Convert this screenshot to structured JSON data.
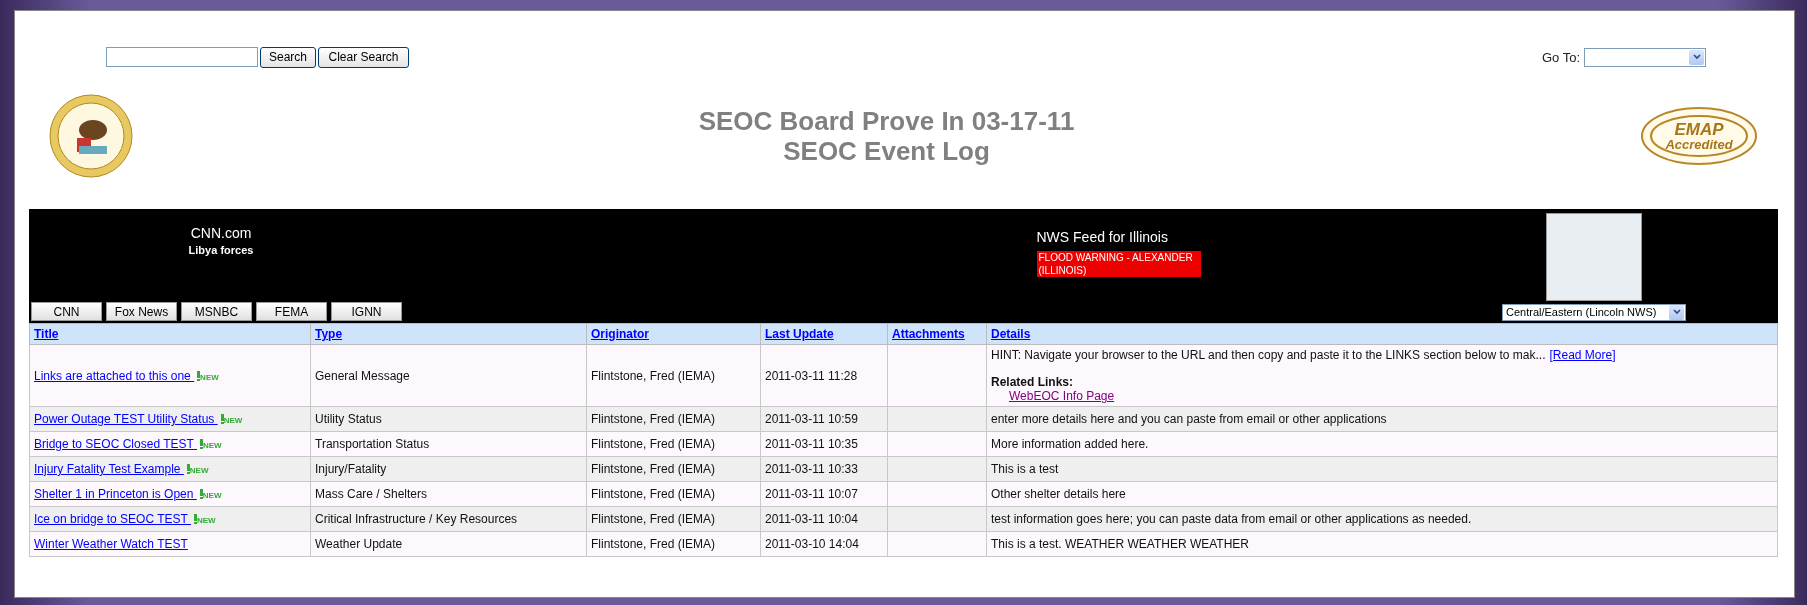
{
  "search": {
    "button": "Search",
    "clear_button": "Clear Search"
  },
  "goto": {
    "label": "Go To:"
  },
  "header": {
    "title": "SEOC Board Prove In 03-17-11",
    "subtitle": "SEOC Event Log",
    "badge_logo": {
      "top": "EMAP",
      "bottom": "Accredited"
    }
  },
  "news": {
    "source": "CNN.com",
    "headline": "Libya forces",
    "tabs": [
      {
        "label": "CNN"
      },
      {
        "label": "Fox News"
      },
      {
        "label": "MSNBC"
      },
      {
        "label": "FEMA"
      },
      {
        "label": "IGNN"
      }
    ]
  },
  "nws": {
    "title": "NWS Feed for Illinois",
    "alert": "FLOOD WARNING - ALEXANDER (ILLINOIS)",
    "office_select": "Central/Eastern (Lincoln NWS)"
  },
  "table": {
    "columns": [
      "Title",
      "Type",
      "Originator",
      "Last Update",
      "Attachments",
      "Details"
    ],
    "rows": [
      {
        "title": "Links are attached to this one ",
        "badge": "NEW",
        "type": "General Message",
        "originator": "Flintstone, Fred (IEMA)",
        "updated": "2011-03-11 11:28",
        "details": "HINT: Navigate your browser to the URL and then copy and paste it to the LINKS section below to mak...",
        "read_more": "[Read More]",
        "related_heading": "Related Links:",
        "related_links": [
          "WebEOC Info Page"
        ]
      },
      {
        "title": "Power Outage TEST Utility Status ",
        "badge": "NEW",
        "type": "Utility Status",
        "originator": "Flintstone, Fred (IEMA)",
        "updated": "2011-03-11 10:59",
        "details": "enter more details here and you can paste from email or other applications"
      },
      {
        "title": "Bridge to SEOC Closed TEST ",
        "badge": "NEW",
        "type": "Transportation Status",
        "originator": "Flintstone, Fred (IEMA)",
        "updated": "2011-03-11 10:35",
        "details": "More information added here."
      },
      {
        "title": "Injury Fatality Test Example ",
        "badge": "NEW",
        "type": "Injury/Fatality",
        "originator": "Flintstone, Fred (IEMA)",
        "updated": "2011-03-11 10:33",
        "details": "This is a test"
      },
      {
        "title": "Shelter 1 in Princeton is Open ",
        "badge": "NEW",
        "type": "Mass Care / Shelters",
        "originator": "Flintstone, Fred (IEMA)",
        "updated": "2011-03-11 10:07",
        "details": "Other shelter details here"
      },
      {
        "title": "Ice on bridge to SEOC TEST ",
        "badge": "NEW",
        "type": "Critical Infrastructure / Key Resources",
        "originator": "Flintstone, Fred (IEMA)",
        "updated": "2011-03-11 10:04",
        "details": "test information goes here; you can paste data from email or other applications as needed."
      },
      {
        "title": "Winter Weather Watch TEST ",
        "type": "Weather Update",
        "originator": "Flintstone, Fred (IEMA)",
        "updated": "2011-03-10 14:04",
        "details": "This is a test. WEATHER WEATHER WEATHER"
      }
    ]
  }
}
